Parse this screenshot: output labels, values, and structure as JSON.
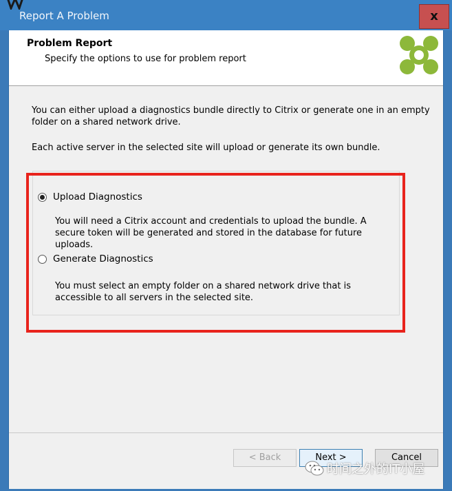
{
  "window": {
    "title": "Report A Problem",
    "close_label": "x",
    "icon": "app-icon",
    "colors": {
      "titlebar": "#3b82c4",
      "close": "#c75050"
    }
  },
  "header": {
    "title": "Problem Report",
    "subtitle": "Specify the options to use for problem report",
    "logo": "citrix-logo"
  },
  "intro": {
    "line1": "You can either upload a diagnostics bundle directly to Citrix or generate one in an empty folder on a shared network drive.",
    "line2": "Each active server in the selected site will upload or generate its own bundle."
  },
  "options": [
    {
      "label": "Upload Diagnostics",
      "selected": true,
      "description": "You will need a Citrix account and credentials to upload the bundle. A secure token will be generated and stored in the database for future uploads."
    },
    {
      "label": "Generate Diagnostics",
      "selected": false,
      "description": "You must select an empty folder on a shared network drive that is accessible to all servers in the selected site."
    }
  ],
  "highlight_color": "#e8231c",
  "buttons": {
    "back": "< Back",
    "next": "Next >",
    "cancel": "Cancel"
  },
  "watermark": {
    "text": "时间之外的IT小屋",
    "icon": "wechat-icon"
  }
}
